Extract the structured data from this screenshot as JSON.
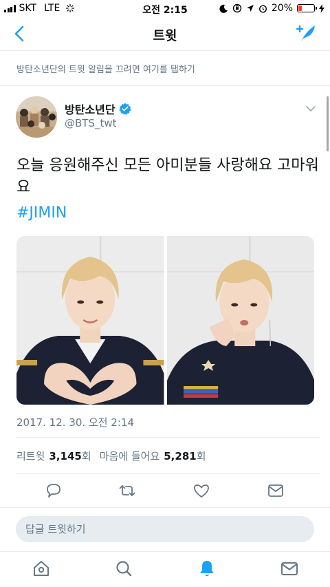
{
  "status_bar": {
    "carrier": "SKT",
    "network": "LTE",
    "time": "오전 2:15",
    "battery_percent": "20%",
    "battery_level": 0.2
  },
  "nav": {
    "title": "트윗",
    "back_icon": "chevron-left-icon",
    "compose_icon": "compose-tweet-icon"
  },
  "notice": {
    "text": "방탄소년단의 트윗 알림을 끄려면 여기를 탭하기"
  },
  "tweet": {
    "display_name": "방탄소년단",
    "handle": "@BTS_twt",
    "text": "오늘 응원해주신 모든 아미분들 사랑해요 고마워요",
    "hashtag": "#JIMIN",
    "timestamp": "2017. 12. 30. 오전 2:14",
    "retweet_label": "리트윗",
    "retweet_count": "3,145",
    "count_suffix": "회",
    "like_label": "마음에 들어요",
    "like_count": "5,281"
  },
  "reply": {
    "placeholder": "답글 트윗하기"
  },
  "colors": {
    "accent": "#1da1f2",
    "secondary_text": "#657786",
    "divider": "#e6ecf0"
  },
  "tab_bar": {
    "items": [
      "home-icon",
      "search-icon",
      "notifications-icon",
      "messages-icon"
    ],
    "active": "notifications-icon"
  }
}
